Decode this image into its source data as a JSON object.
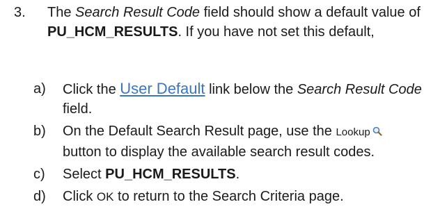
{
  "step": {
    "number": "3.",
    "seg1": "The ",
    "field_name": "Search Result Code",
    "seg2": " field should show a default value of ",
    "default_value": "PU_HCM_RESULTS",
    "seg3": ". If you have not set this default,"
  },
  "substeps": [
    {
      "letter": "a)",
      "seg1": "Click the ",
      "link_text": "User Default",
      "seg2": " link below the ",
      "field_name": "Search Result Code",
      "seg3": " field."
    },
    {
      "letter": "b)",
      "seg1": "On the Default Search Result page, use the ",
      "button_label": "Lookup",
      "icon": "magnifier-icon",
      "seg2": " button to display the available search result codes."
    },
    {
      "letter": "c)",
      "seg1": "Select ",
      "value": "PU_HCM_RESULTS",
      "seg2": "."
    },
    {
      "letter": "d)",
      "seg1": "Click ",
      "button_label": "OK",
      "seg2": " to return to the Search Criteria page."
    }
  ]
}
